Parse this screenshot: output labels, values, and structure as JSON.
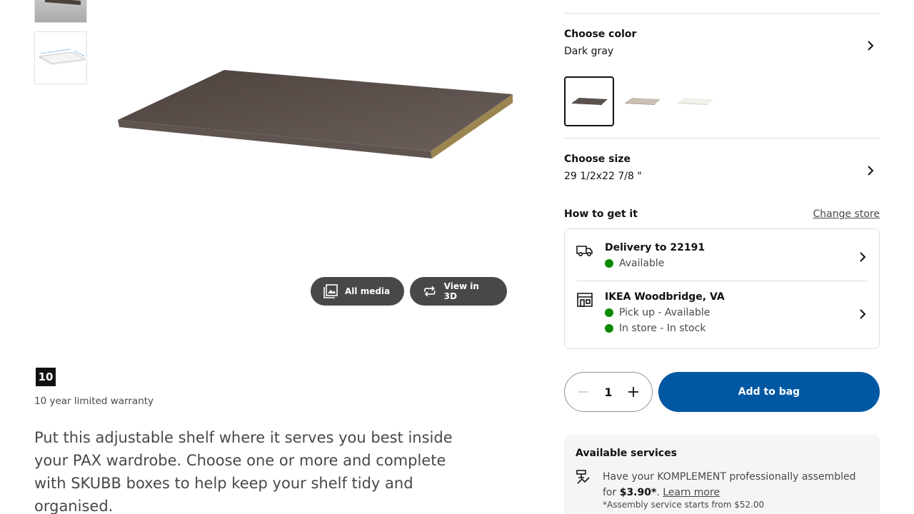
{
  "gallery": {
    "all_media_label": "All media",
    "view_3d_label": "View in 3D"
  },
  "warranty": {
    "badge": "10",
    "text": "10 year limited warranty"
  },
  "summary": "Put this adjustable shelf where it serves you best inside your PAX wardrobe. Choose one or more and complete with SKUBB boxes to help keep your shelf tidy and organised.",
  "color": {
    "title": "Choose color",
    "value": "Dark gray",
    "swatches": [
      {
        "name": "dark-gray",
        "color": "#5a504c",
        "selected": true
      },
      {
        "name": "beige",
        "color": "#c9bfb2",
        "selected": false
      },
      {
        "name": "white",
        "color": "#f1f0ea",
        "selected": false
      }
    ]
  },
  "size": {
    "title": "Choose size",
    "value": "29 1/2x22 7/8 \""
  },
  "availability": {
    "title": "How to get it",
    "change_store": "Change store",
    "delivery": {
      "title": "Delivery to 22191",
      "status": "Available",
      "icon": "truck-icon"
    },
    "store": {
      "title": "IKEA Woodbridge, VA",
      "pickup": "Pick up - Available",
      "instore": "In store - In stock",
      "icon": "store-icon"
    },
    "status_color": "#0a8a00"
  },
  "cart": {
    "quantity": "1",
    "add_label": "Add to bag",
    "accent": "#0058a3"
  },
  "services": {
    "title": "Available services",
    "text_prefix": "Have your KOMPLEMENT professionally assembled for ",
    "price": "$3.90*",
    "separator": ". ",
    "learn_more": "Learn more",
    "note": "*Assembly service starts from $52.00"
  }
}
